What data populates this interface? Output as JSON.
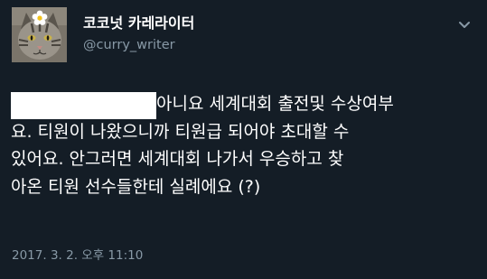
{
  "tweet": {
    "author": {
      "display_name": "코코넛 카레라이터",
      "handle": "@curry_writer",
      "avatar_icon": "cat-avatar-icon"
    },
    "menu_icon": "chevron-down-icon",
    "body_lines": [
      "아니요 세계대회 출전및 수상여부",
      "요. 티원이 나왔으니까 티원급 되어야 초대할 수",
      "있어요. 안그러면 세계대회 나가서 우승하고 찾",
      "아온 티원 선수들한테 실례에요 (?)"
    ],
    "timestamp": "2017. 3. 2. 오후 11:10"
  },
  "colors": {
    "background": "#141d26",
    "text_primary": "#ffffff",
    "text_secondary": "#8899a6"
  }
}
